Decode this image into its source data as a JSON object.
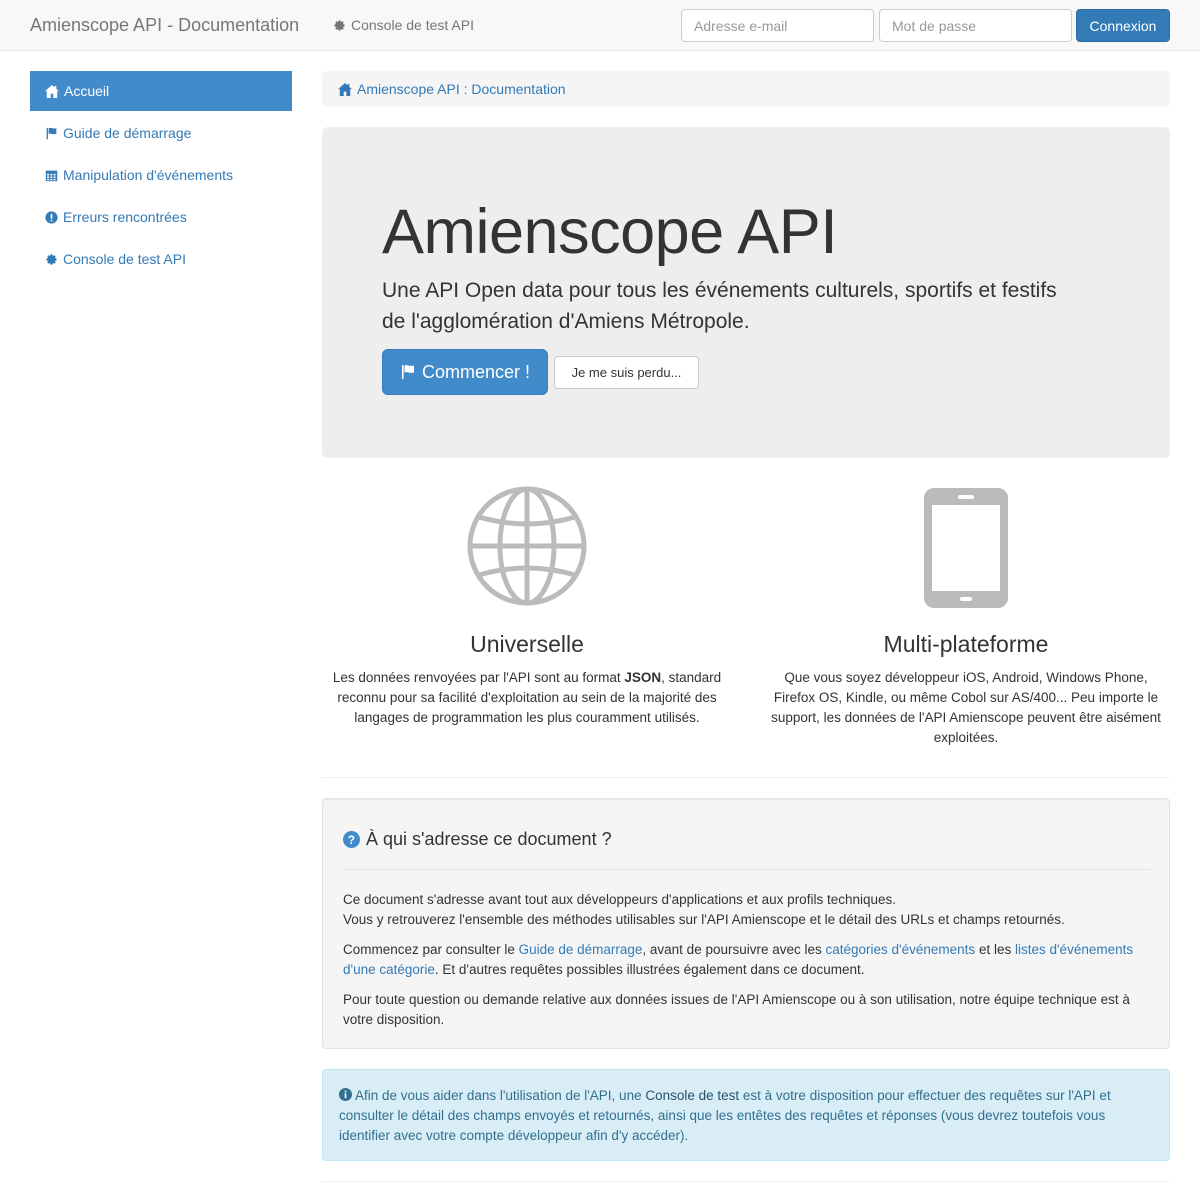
{
  "navbar": {
    "brand": "Amienscope API - Documentation",
    "console_link": "Console de test API",
    "email_placeholder": "Adresse e-mail",
    "password_placeholder": "Mot de passe",
    "login_label": "Connexion"
  },
  "sidebar": {
    "items": [
      {
        "label": "Accueil",
        "icon": "home-icon",
        "active": true
      },
      {
        "label": "Guide de démarrage",
        "icon": "flag-icon"
      },
      {
        "label": "Manipulation d'événements",
        "icon": "calendar-icon"
      },
      {
        "label": "Erreurs rencontrées",
        "icon": "exclamation-circle-icon"
      },
      {
        "label": "Console de test API",
        "icon": "gear-icon"
      }
    ]
  },
  "breadcrumb": {
    "label": "Amienscope API : Documentation"
  },
  "jumbotron": {
    "title": "Amienscope API",
    "lead": "Une API Open data pour tous les événements culturels, sportifs et festifs de l'agglomération d'Amiens Métropole.",
    "start_button": "Commencer !",
    "lost_button": "Je me suis perdu..."
  },
  "features": [
    {
      "icon": "globe-icon",
      "title": "Universelle",
      "text_before": "Les données renvoyées par l'API sont au format ",
      "text_bold": "JSON",
      "text_after": ", standard reconnu pour sa facilité d'exploitation au sein de la majorité des langages de programmation les plus couramment utilisés."
    },
    {
      "icon": "tablet-icon",
      "title": "Multi-plateforme",
      "text": "Que vous soyez développeur iOS, Android, Windows Phone, Firefox OS, Kindle, ou même Cobol sur AS/400... Peu importe le support, les données de l'API Amienscope peuvent être aisément exploitées."
    }
  ],
  "audience": {
    "title": "À qui s'adresse ce document ?",
    "p1_line1": "Ce document s'adresse avant tout aux développeurs d'applications et aux profils techniques.",
    "p1_line2": "Vous y retrouverez l'ensemble des méthodes utilisables sur l'API Amienscope et le détail des URLs et champs retournés.",
    "p2_a": "Commencez par consulter le ",
    "p2_link1": "Guide de démarrage",
    "p2_b": ", avant de poursuivre avec les ",
    "p2_link2": "catégories d'événements",
    "p2_c": " et les ",
    "p2_link3": "listes d'événements d'une catégorie",
    "p2_d": ". Et d'autres requêtes possibles illustrées également dans ce document.",
    "p3": "Pour toute question ou demande relative aux données issues de l'API Amienscope ou à son utilisation, notre équipe technique est à votre disposition."
  },
  "alert": {
    "text_a": " Afin de vous aider dans l'utilisation de l'API, une ",
    "link": "Console de test",
    "text_b": " est à votre disposition pour effectuer des requêtes sur l'API et consulter le détail des champs envoyés et retournés, ainsi que les entêtes des requêtes et réponses (vous devrez toutefois vous identifier avec votre compte développeur afin d'y accéder)."
  },
  "colors": {
    "primary": "#337ab7",
    "active_nav": "#428bca",
    "jumbotron_bg": "#eeeeee",
    "alert_bg": "#d9edf7",
    "alert_text": "#31708f",
    "icon_gray": "#bbbbbb"
  }
}
